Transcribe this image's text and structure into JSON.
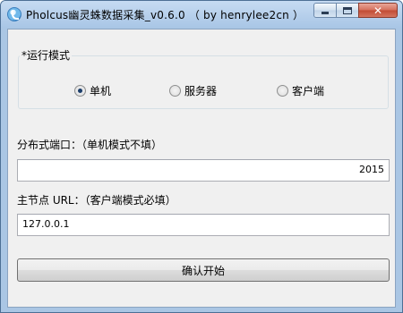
{
  "window": {
    "title": "Pholcus幽灵蛛数据采集_v0.6.0 （ by henrylee2cn ）",
    "close_symbol": "✕"
  },
  "run_mode": {
    "group_label": "*运行模式",
    "options": [
      {
        "label": "单机",
        "checked": true
      },
      {
        "label": "服务器",
        "checked": false
      },
      {
        "label": "客户端",
        "checked": false
      }
    ]
  },
  "port": {
    "label": "分布式端口：（单机模式不填）",
    "value": "2015"
  },
  "master_url": {
    "label": "主节点 URL：（客户端模式必填）",
    "value": "127.0.0.1"
  },
  "actions": {
    "start_label": "确认开始"
  }
}
